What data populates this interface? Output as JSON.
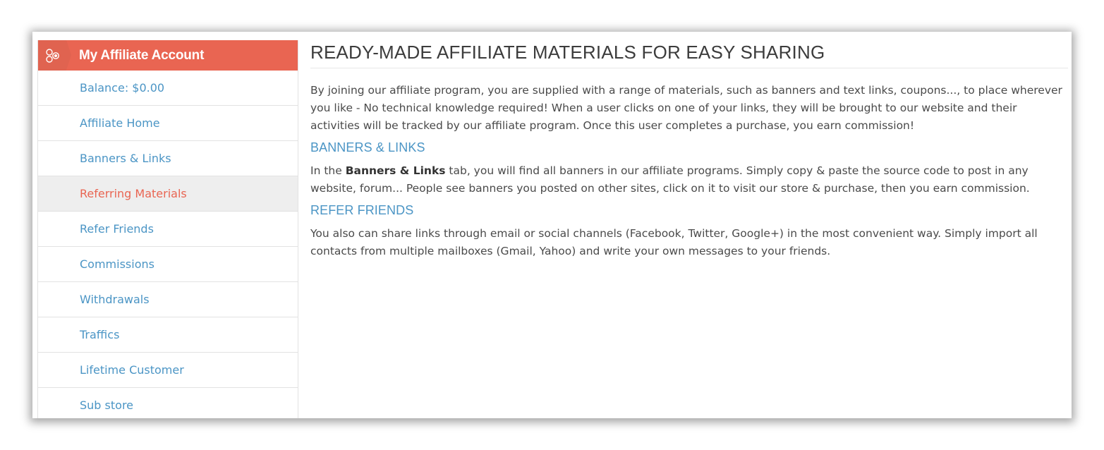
{
  "sidebar": {
    "title": "My Affiliate Account",
    "icon": "affiliate-network-icon",
    "items": [
      {
        "label": "Balance: $0.00"
      },
      {
        "label": "Affiliate Home"
      },
      {
        "label": "Banners & Links"
      },
      {
        "label": "Referring Materials",
        "active": true
      },
      {
        "label": "Refer Friends"
      },
      {
        "label": "Commissions"
      },
      {
        "label": "Withdrawals"
      },
      {
        "label": "Traffics"
      },
      {
        "label": "Lifetime Customer"
      },
      {
        "label": "Sub store"
      }
    ]
  },
  "main": {
    "title": "READY-MADE AFFILIATE MATERIALS FOR EASY SHARING",
    "intro": "By joining our affiliate program, you are supplied with a range of materials, such as banners and text links, coupons..., to place wherever you like - No technical knowledge required! When a user clicks on one of your links, they will be brought to our website and their activities will be tracked by our affiliate program. Once this user completes a purchase, you earn commission!",
    "sections": [
      {
        "heading": "BANNERS & LINKS",
        "text_before": "In the ",
        "text_bold": "Banners & Links",
        "text_after": " tab, you will find all banners in our affiliate programs. Simply copy & paste the source code to post in any website, forum... People see banners you posted on other sites, click on it to visit our store & purchase, then you earn commission."
      },
      {
        "heading": "REFER FRIENDS",
        "text": "You also can share links through email or social channels (Facebook, Twitter, Google+) in the most convenient way. Simply import all contacts from multiple mailboxes (Gmail, Yahoo) and write your own messages to your friends."
      }
    ]
  },
  "colors": {
    "accent": "#e96552",
    "link": "#4b95c5",
    "active_bg": "#eeeeee",
    "text": "#4a4a4a"
  }
}
